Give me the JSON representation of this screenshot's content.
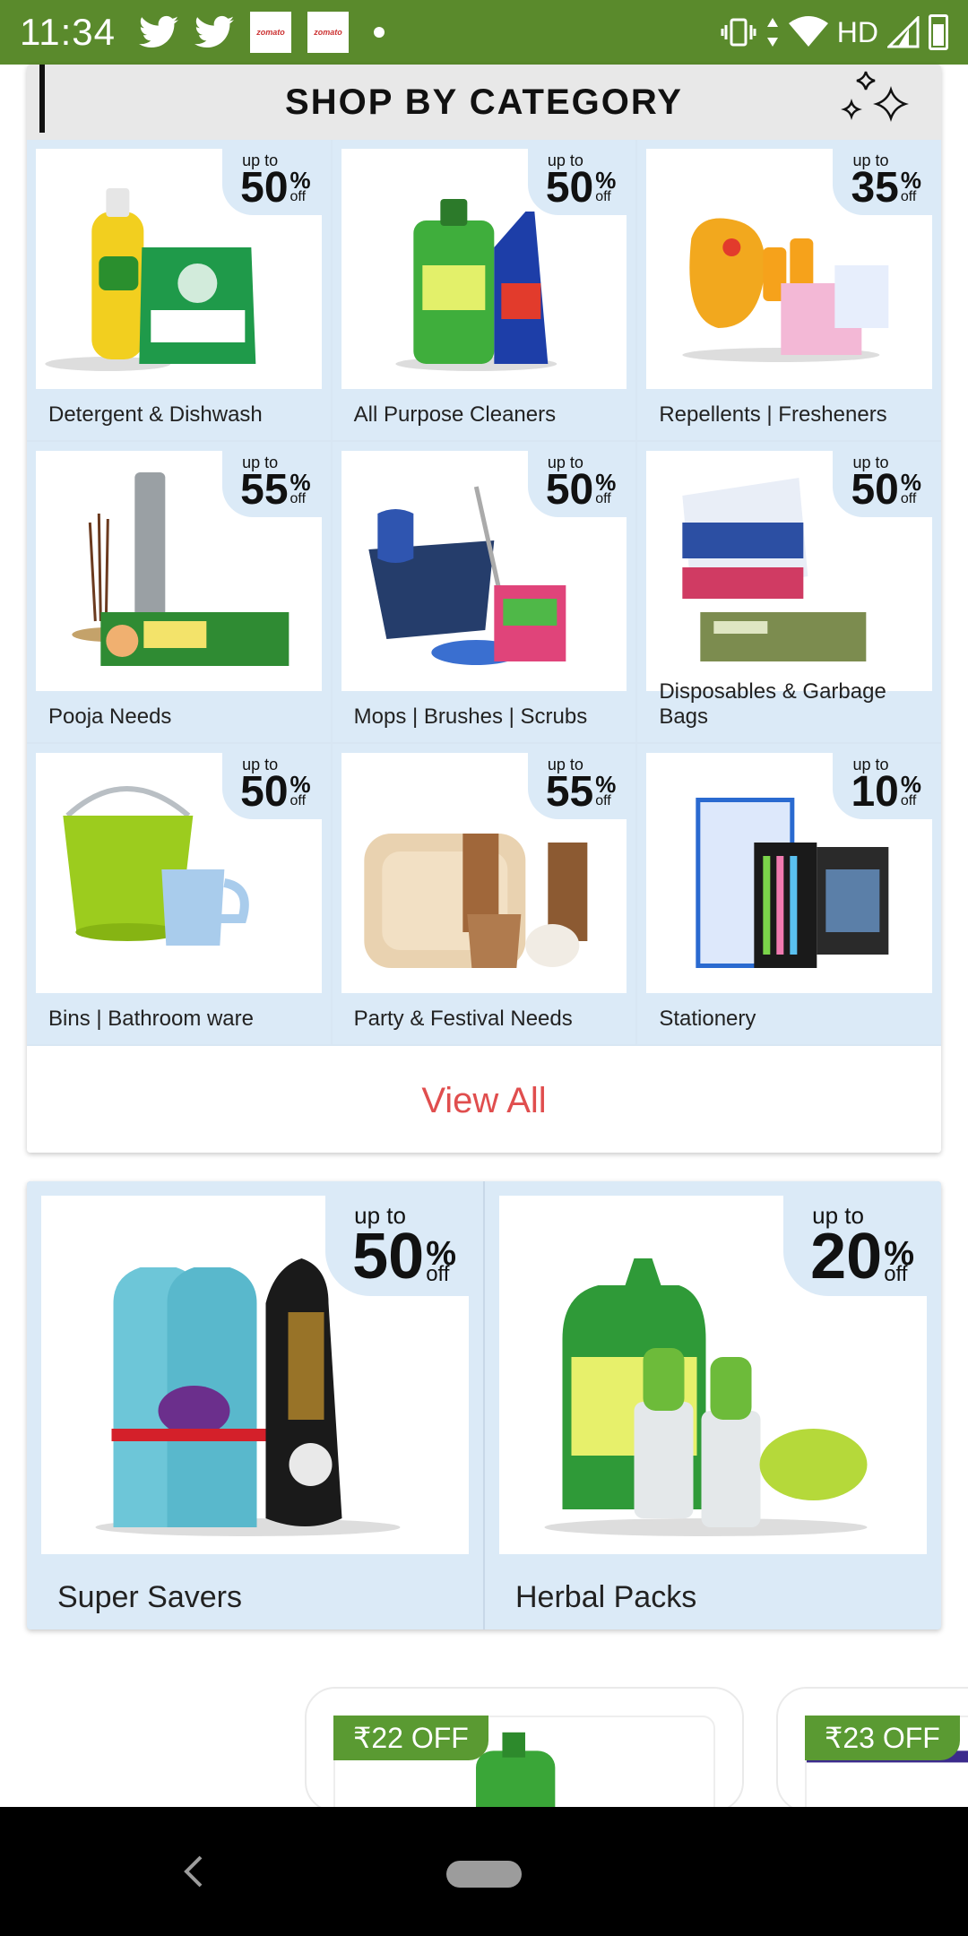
{
  "status_bar": {
    "time": "11:34",
    "left_icons": [
      "twitter-icon",
      "twitter-icon",
      "zomato-icon",
      "zomato-icon",
      "dot-icon"
    ],
    "zomato_text": "zomato",
    "network": "HD",
    "right_icons": [
      "vibrate-icon",
      "data-arrows-icon",
      "wifi-icon",
      "signal-icon",
      "battery-icon"
    ]
  },
  "category_section": {
    "title": "SHOP BY CATEGORY",
    "upto_label": "up to",
    "percent_sign": "%",
    "off_label": "off",
    "tiles": [
      {
        "label": "Detergent & Dishwash",
        "discount": "50"
      },
      {
        "label": "All Purpose Cleaners",
        "discount": "50"
      },
      {
        "label": "Repellents | Fresheners",
        "discount": "35"
      },
      {
        "label": "Pooja Needs",
        "discount": "55"
      },
      {
        "label": "Mops | Brushes | Scrubs",
        "discount": "50"
      },
      {
        "label": "Disposables & Garbage Bags",
        "discount": "50"
      },
      {
        "label": "Bins | Bathroom ware",
        "discount": "50"
      },
      {
        "label": "Party & Festival Needs",
        "discount": "55"
      },
      {
        "label": "Stationery",
        "discount": "10"
      }
    ],
    "view_all": "View All"
  },
  "promo_section": {
    "tiles": [
      {
        "label": "Super Savers",
        "discount": "50"
      },
      {
        "label": "Herbal Packs",
        "discount": "20"
      }
    ]
  },
  "offers": [
    {
      "tag": "₹22 OFF"
    },
    {
      "tag": "₹23 OFF"
    }
  ],
  "colors": {
    "status_bar": "#5a8a2c",
    "tile_bg": "#dbeaf7",
    "view_all": "#e04e4e",
    "offer_tag": "#5a9a32"
  }
}
